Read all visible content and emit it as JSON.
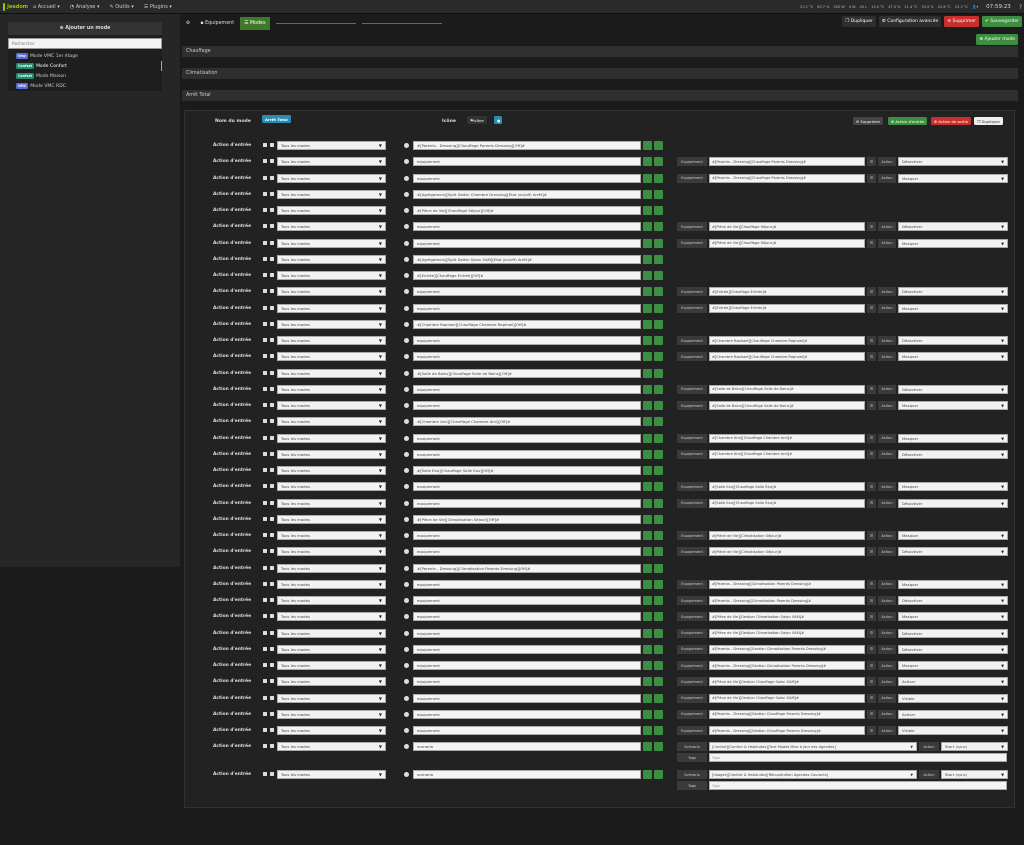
{
  "navbar": {
    "logo": "Jeedom",
    "menu": [
      "Accueil",
      "Analyse",
      "Outils",
      "Plugins"
    ],
    "status": [
      "23,1 °C",
      "63,7 %",
      "520 W",
      "0 W",
      "40 L",
      "13,0 °C",
      "47,0 %",
      "21,4 °C",
      "53,0 %",
      "22,8 °C",
      "23,3 °C"
    ],
    "clock": "07:59:23"
  },
  "left": {
    "add_mode_label": "Ajouter un mode",
    "search_placeholder": "Rechercher",
    "modes": [
      {
        "badge": "Vmc",
        "badge_color": "#5b6bd6",
        "label": "Mode VMC 1er étage"
      },
      {
        "badge": "Confort",
        "badge_color": "#1f8c6e",
        "label": "Mode Confort",
        "active": true
      },
      {
        "badge": "Confort",
        "badge_color": "#1f8c6e",
        "label": "Mode Maison"
      },
      {
        "badge": "VMC",
        "badge_color": "#5b6bd6",
        "label": "Mode VMC RDC"
      }
    ]
  },
  "main": {
    "tabs": [
      "Equipement",
      "Modes"
    ],
    "buttons": {
      "duplicate": "Dupliquer",
      "advanced": "Configuration avancée",
      "delete": "Supprimer",
      "save": "Sauvegarder",
      "add_mode": "Ajouter mode"
    },
    "sections": [
      "Chauffage",
      "Climatisation",
      "Arrêt Total"
    ],
    "panel": {
      "name_label": "Nom du mode",
      "name_value": "Arrêt Total",
      "icon_label": "Icône",
      "icon_btn": "Icône",
      "chips": [
        "Supprimer",
        "Action d'entrée",
        "Action de sortie",
        "Dupliquer"
      ]
    },
    "rows": [
      {
        "label": "Action d'entrée",
        "mode": "Tous les modes",
        "cmd": "#[Parents - Dressing][Chauffage Parents Dressing][Off]#",
        "eq": "",
        "action": ""
      },
      {
        "label": "Action d'entrée",
        "mode": "Tous les modes",
        "cmd": "equipement",
        "eq": "#[Parents - Dressing][Chauffage Parents Dressing]#",
        "action": "Désactiver"
      },
      {
        "label": "Action d'entrée",
        "mode": "Tous les modes",
        "cmd": "equipement",
        "eq": "#[Parents - Dressing][Chauffage Parents Dressing]#",
        "action": "Masquer"
      },
      {
        "label": "Action d'entrée",
        "mode": "Tous les modes",
        "cmd": "#[Agrégateurs][Split Daikin Chambre Dressing][Etat (on/off) Arrêt]#",
        "eq": "",
        "action": ""
      },
      {
        "label": "Action d'entrée",
        "mode": "Tous les modes",
        "cmd": "#[Pièce de Vie][Chauffage Séjour][Off]#",
        "eq": "",
        "action": ""
      },
      {
        "label": "Action d'entrée",
        "mode": "Tous les modes",
        "cmd": "equipement",
        "eq": "#[Pièce de Vie][Chauffage Séjour]#",
        "action": "Désactiver"
      },
      {
        "label": "Action d'entrée",
        "mode": "Tous les modes",
        "cmd": "equipement",
        "eq": "#[Pièce de Vie][Chauffage Séjour]#",
        "action": "Masquer"
      },
      {
        "label": "Action d'entrée",
        "mode": "Tous les modes",
        "cmd": "#[Agrégateurs][Split Daikin Salon SAM][Etat (on/off) Arrêt]#",
        "eq": "",
        "action": ""
      },
      {
        "label": "Action d'entrée",
        "mode": "Tous les modes",
        "cmd": "#[Entrée][Chauffage Entrée][Off]#",
        "eq": "",
        "action": ""
      },
      {
        "label": "Action d'entrée",
        "mode": "Tous les modes",
        "cmd": "equipement",
        "eq": "#[Entrée][Chauffage Entrée]#",
        "action": "Désactiver"
      },
      {
        "label": "Action d'entrée",
        "mode": "Tous les modes",
        "cmd": "equipement",
        "eq": "#[Entrée][Chauffage Entrée]#",
        "action": "Masquer"
      },
      {
        "label": "Action d'entrée",
        "mode": "Tous les modes",
        "cmd": "#[Chambre Raphael][Chauffage Chambre Raphael][Off]#",
        "eq": "",
        "action": ""
      },
      {
        "label": "Action d'entrée",
        "mode": "Tous les modes",
        "cmd": "equipement",
        "eq": "#[Chambre Raphael][Chauffage Chambre Raphael]#",
        "action": "Désactiver"
      },
      {
        "label": "Action d'entrée",
        "mode": "Tous les modes",
        "cmd": "equipement",
        "eq": "#[Chambre Raphael][Chauffage Chambre Raphael]#",
        "action": "Masquer"
      },
      {
        "label": "Action d'entrée",
        "mode": "Tous les modes",
        "cmd": "#[Salle de Bains][Chauffage Salle de Bains][Off]#",
        "eq": "",
        "action": ""
      },
      {
        "label": "Action d'entrée",
        "mode": "Tous les modes",
        "cmd": "equipement",
        "eq": "#[Salle de Bains][Chauffage Salle de Bains]#",
        "action": "Désactiver"
      },
      {
        "label": "Action d'entrée",
        "mode": "Tous les modes",
        "cmd": "equipement",
        "eq": "#[Salle de Bains][Chauffage Salle de Bains]#",
        "action": "Masquer"
      },
      {
        "label": "Action d'entrée",
        "mode": "Tous les modes",
        "cmd": "#[Chambre Ami][Chauffage Chambre Ami][Off]#",
        "eq": "",
        "action": ""
      },
      {
        "label": "Action d'entrée",
        "mode": "Tous les modes",
        "cmd": "equipement",
        "eq": "#[Chambre Ami][Chauffage Chambre Ami]#",
        "action": "Masquer"
      },
      {
        "label": "Action d'entrée",
        "mode": "Tous les modes",
        "cmd": "equipement",
        "eq": "#[Chambre Ami][Chauffage Chambre Ami]#",
        "action": "Désactiver"
      },
      {
        "label": "Action d'entrée",
        "mode": "Tous les modes",
        "cmd": "#[Salle Eau][Chauffage Salle Eau][Off]#",
        "eq": "",
        "action": ""
      },
      {
        "label": "Action d'entrée",
        "mode": "Tous les modes",
        "cmd": "equipement",
        "eq": "#[Salle Eau][Chauffage Salle Eau]#",
        "action": "Masquer"
      },
      {
        "label": "Action d'entrée",
        "mode": "Tous les modes",
        "cmd": "equipement",
        "eq": "#[Salle Eau][Chauffage Salle Eau]#",
        "action": "Désactiver"
      },
      {
        "label": "Action d'entrée",
        "mode": "Tous les modes",
        "cmd": "#[Pièce de Vie][Climatisation Séjour][Off]#",
        "eq": "",
        "action": ""
      },
      {
        "label": "Action d'entrée",
        "mode": "Tous les modes",
        "cmd": "equipement",
        "eq": "#[Pièce de Vie][Climatisation Séjour]#",
        "action": "Masquer"
      },
      {
        "label": "Action d'entrée",
        "mode": "Tous les modes",
        "cmd": "equipement",
        "eq": "#[Pièce de Vie][Climatisation Séjour]#",
        "action": "Désactiver"
      },
      {
        "label": "Action d'entrée",
        "mode": "Tous les modes",
        "cmd": "#[Parents - Dressing][Climatisation Parents Dressing][Off]#",
        "eq": "",
        "action": ""
      },
      {
        "label": "Action d'entrée",
        "mode": "Tous les modes",
        "cmd": "equipement",
        "eq": "#[Parents - Dressing][Climatisation Parents Dressing]#",
        "action": "Masquer"
      },
      {
        "label": "Action d'entrée",
        "mode": "Tous les modes",
        "cmd": "equipement",
        "eq": "#[Parents - Dressing][Climatisation Parents Dressing]#",
        "action": "Désactiver"
      },
      {
        "label": "Action d'entrée",
        "mode": "Tous les modes",
        "cmd": "equipement",
        "eq": "#[Pièce de Vie][Gestion Climatisation Salon SAM]#",
        "action": "Masquer"
      },
      {
        "label": "Action d'entrée",
        "mode": "Tous les modes",
        "cmd": "equipement",
        "eq": "#[Pièce de Vie][Gestion Climatisation Salon SAM]#",
        "action": "Désactiver"
      },
      {
        "label": "Action d'entrée",
        "mode": "Tous les modes",
        "cmd": "equipement",
        "eq": "#[Parents - Dressing][Gestion Climatisation Parents Dressing]#",
        "action": "Désactiver"
      },
      {
        "label": "Action d'entrée",
        "mode": "Tous les modes",
        "cmd": "equipement",
        "eq": "#[Parents - Dressing][Gestion Climatisation Parents Dressing]#",
        "action": "Masquer"
      },
      {
        "label": "Action d'entrée",
        "mode": "Tous les modes",
        "cmd": "equipement",
        "eq": "#[Pièce de Vie][Gestion Chauffage Salon SAM]#",
        "action": "Activer"
      },
      {
        "label": "Action d'entrée",
        "mode": "Tous les modes",
        "cmd": "equipement",
        "eq": "#[Pièce de Vie][Gestion Chauffage Salon SAM]#",
        "action": "Visible"
      },
      {
        "label": "Action d'entrée",
        "mode": "Tous les modes",
        "cmd": "equipement",
        "eq": "#[Parents - Dressing][Gestion Chauffage Parents Dressing]#",
        "action": "Activer"
      },
      {
        "label": "Action d'entrée",
        "mode": "Tous les modes",
        "cmd": "equipement",
        "eq": "#[Parents - Dressing][Gestion Chauffage Parents Dressing]#",
        "action": "Visible"
      }
    ],
    "scenario_rows": [
      {
        "label": "Action d'entrée",
        "mode": "Tous les modes",
        "cmd": "scenario",
        "scen_label": "Scénario",
        "scen": "[Confort][Confort & Habitudes][Tout Modes Mise à jour des Agendas]",
        "action_label": "Action",
        "action": "Start (sync)",
        "tags_label": "Tags",
        "tags": "Tags"
      },
      {
        "label": "Action d'entrée",
        "mode": "Tous les modes",
        "cmd": "scenario",
        "scen_label": "Scénario",
        "scen": "[Usages][Confort & Habitudes][Récupération Agendas Courants]",
        "action_label": "Action",
        "action": "Start (sync)",
        "tags_label": "Tags",
        "tags": "Tags"
      }
    ],
    "eq_label": "Equipement",
    "action_label": "Action"
  }
}
